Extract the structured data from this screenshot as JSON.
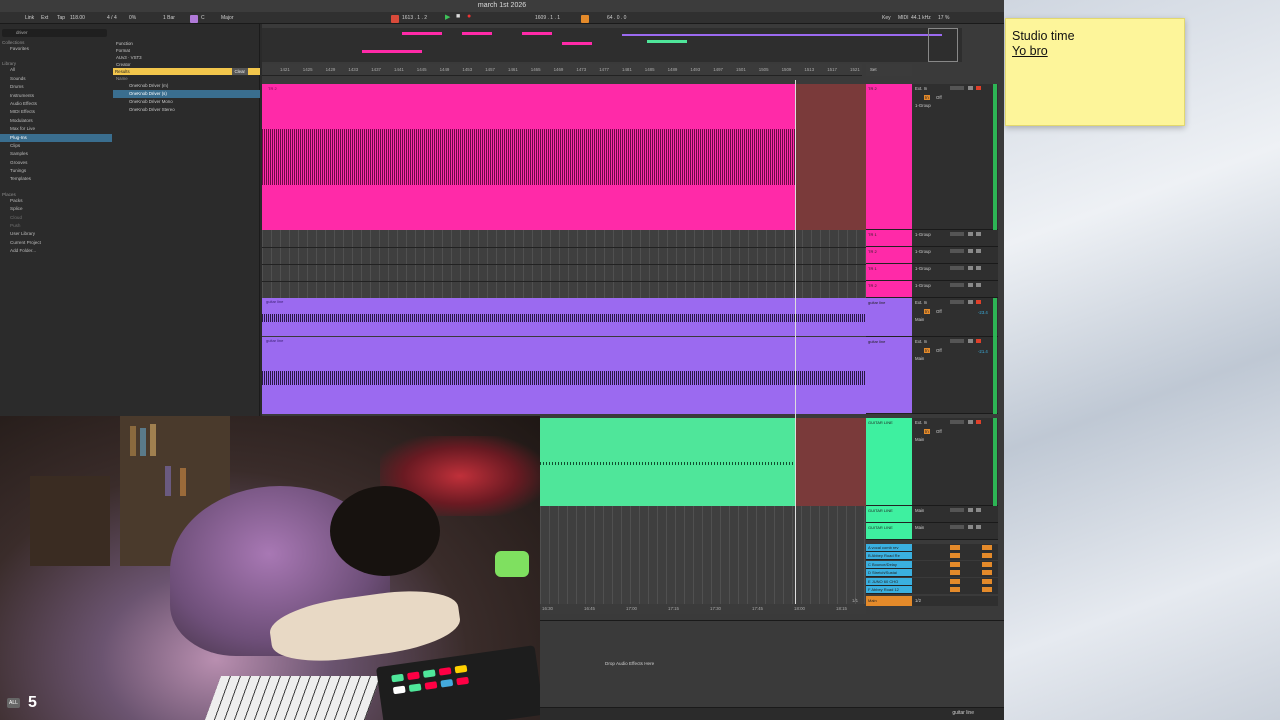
{
  "app": {
    "title": "march 1st 2026"
  },
  "transport": {
    "link": "Link",
    "ext": "Ext",
    "tap": "Tap",
    "tempo": "118.00",
    "signature": "4 / 4",
    "swing": "0%",
    "bar": "1 Bar",
    "key": "C",
    "scale": "Major",
    "position": "1613 . 1 . 2",
    "loop_start": "1609 . 1 . 1",
    "loop_length": "64 . 0 . 0",
    "key_label": "Key",
    "midi_label": "MIDI",
    "sample_rate": "44.1 kHz",
    "cpu": "17 %"
  },
  "browser": {
    "search_value": "driver",
    "collections_heading": "Collections",
    "collections": [
      "Favorites"
    ],
    "library_heading": "Library",
    "library": [
      "All",
      "Sounds",
      "Drums",
      "Instruments",
      "Audio Effects",
      "MIDI Effects",
      "Modulators",
      "Max for Live",
      "Plug-Ins",
      "Clips",
      "Samples",
      "Grooves",
      "Tunings",
      "Templates"
    ],
    "places_heading": "Places",
    "places": [
      "Packs",
      "Splice",
      "Cloud",
      "Push",
      "User Library",
      "Current Project",
      "Add Folder..."
    ],
    "filters": [
      "Function",
      "Format",
      "AUv3 · VST3",
      "Creator"
    ],
    "results_label": "Results",
    "clear_label": "Clear",
    "name_header": "Name",
    "files": [
      "OneKnob Driver (m)",
      "OneKnob Driver (s)",
      "OneKnob Driver Mono",
      "OneKnob Driver Stereo"
    ],
    "selected_file": "OneKnob Driver (s)"
  },
  "ruler": {
    "bars": [
      "1421",
      "1425",
      "1429",
      "1433",
      "1437",
      "1441",
      "1445",
      "1449",
      "1453",
      "1457",
      "1461",
      "1465",
      "1469",
      "1473",
      "1477",
      "1481",
      "1485",
      "1489",
      "1493",
      "1497",
      "1501",
      "1505",
      "1509",
      "1513",
      "1517",
      "1521"
    ],
    "set_label": "Set"
  },
  "time_ruler": {
    "ticks": [
      "16:30",
      "16:45",
      "17:00",
      "17:15",
      "17:30",
      "17:45",
      "18:00",
      "18:15"
    ],
    "page": "1/1"
  },
  "tracks": [
    {
      "name": "TR 2",
      "color": "#ff2aa8",
      "input": "Ext. In",
      "route": "1-Group",
      "clip_label": "TR 2"
    },
    {
      "name": "TR 1",
      "color": "#ff2aa8",
      "route": "1-Group"
    },
    {
      "name": "TR 2",
      "color": "#ff2aa8",
      "route": "1-Group"
    },
    {
      "name": "TR 1",
      "color": "#ff2aa8",
      "route": "1-Group"
    },
    {
      "name": "TR 2",
      "color": "#ff2aa8",
      "route": "1-Group"
    },
    {
      "name": "guitar line",
      "color": "#9b6af0",
      "input": "Ext. In",
      "route": "Main",
      "clip_label": "guitar line",
      "volume": "-23.4"
    },
    {
      "name": "guitar line",
      "color": "#9b6af0",
      "input": "Ext. In",
      "route": "Main",
      "clip_label": "guitar line",
      "volume": "-21.4"
    },
    {
      "name": "GUITAR LINE",
      "color": "#3ef0a0",
      "input": "Ext. In",
      "route": "Main"
    },
    {
      "name": "GUITAR LINE",
      "color": "#3ef0a0",
      "route": "Main"
    },
    {
      "name": "GUITAR LINE",
      "color": "#3ef0a0",
      "route": "Main"
    }
  ],
  "return_tracks": [
    {
      "name": "A vocal comb rev",
      "color": "#3ab0e0"
    },
    {
      "name": "B Abbey Road Re",
      "color": "#3ab0e0"
    },
    {
      "name": "C Bounce/Delay",
      "color": "#3ab0e0"
    },
    {
      "name": "D Stretch/Sustai",
      "color": "#3ab0e0"
    },
    {
      "name": "E JUNO 60 CHO",
      "color": "#3ab0e0"
    },
    {
      "name": "F Abbey Road 12",
      "color": "#3ab0e0"
    }
  ],
  "main_track": {
    "name": "Main",
    "route": "1/2"
  },
  "monitor_off": "Off",
  "detail": {
    "drop_hint": "Drop Audio Effects Here",
    "selected_track": "guitar line"
  },
  "sticky_note": {
    "line1": "Studio time",
    "line2": "Yo bro"
  },
  "overlay": {
    "all_label": "ALL",
    "count": "5"
  },
  "colors": {
    "pink_clip": "#ff2aa8",
    "purple_clip": "#9b6af0",
    "green_clip": "#4fe69a",
    "sticky": "#fdf59a"
  }
}
